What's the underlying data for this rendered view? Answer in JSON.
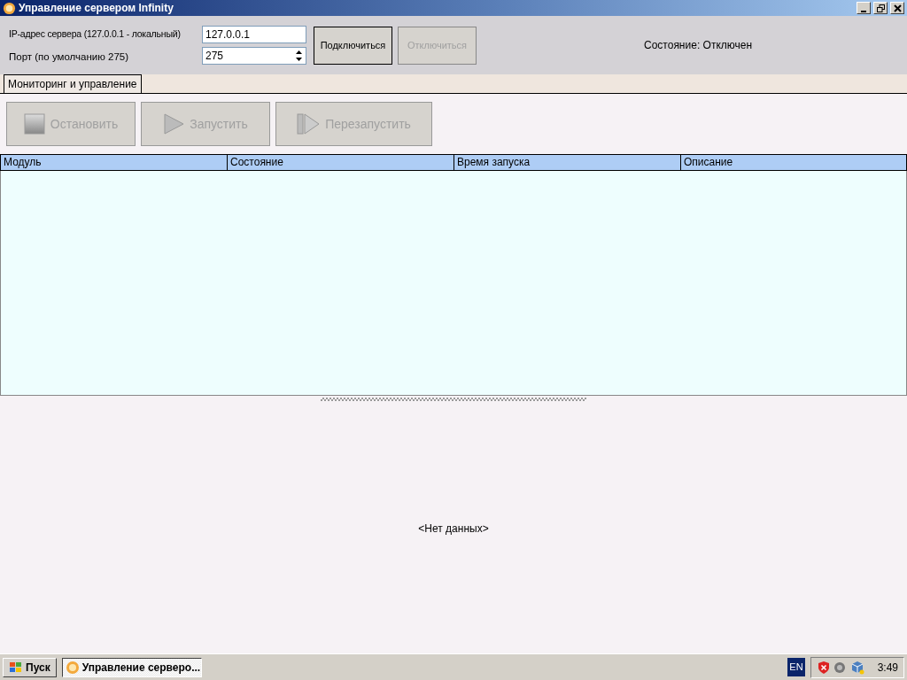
{
  "window": {
    "title": "Управление сервером Infinity"
  },
  "connection": {
    "ip_label": "IP-адрес сервера (127.0.0.1 - локальный)",
    "ip_value": "127.0.0.1",
    "port_label": "Порт (по умолчанию 275)",
    "port_value": "275",
    "buttons": [
      {
        "label": "Подключиться",
        "disabled": false
      },
      {
        "label": "Отключиться",
        "disabled": true
      }
    ],
    "status": "Состояние: Отключен"
  },
  "tabs": [
    {
      "label": "Мониторинг и управление",
      "selected": true
    }
  ],
  "actions": [
    {
      "kind": "stop",
      "label": "Остановить",
      "disabled": true
    },
    {
      "kind": "start",
      "label": "Запустить",
      "disabled": true
    },
    {
      "kind": "restart",
      "label": "Перезапустить",
      "disabled": true
    }
  ],
  "table": {
    "columns": [
      "Модуль",
      "Состояние",
      "Время запуска",
      "Описание"
    ]
  },
  "detail": {
    "empty_text": "<Нет данных>"
  },
  "taskbar": {
    "start": "Пуск",
    "task": "Управление серверо...",
    "language": "EN",
    "clock": "3:49"
  }
}
